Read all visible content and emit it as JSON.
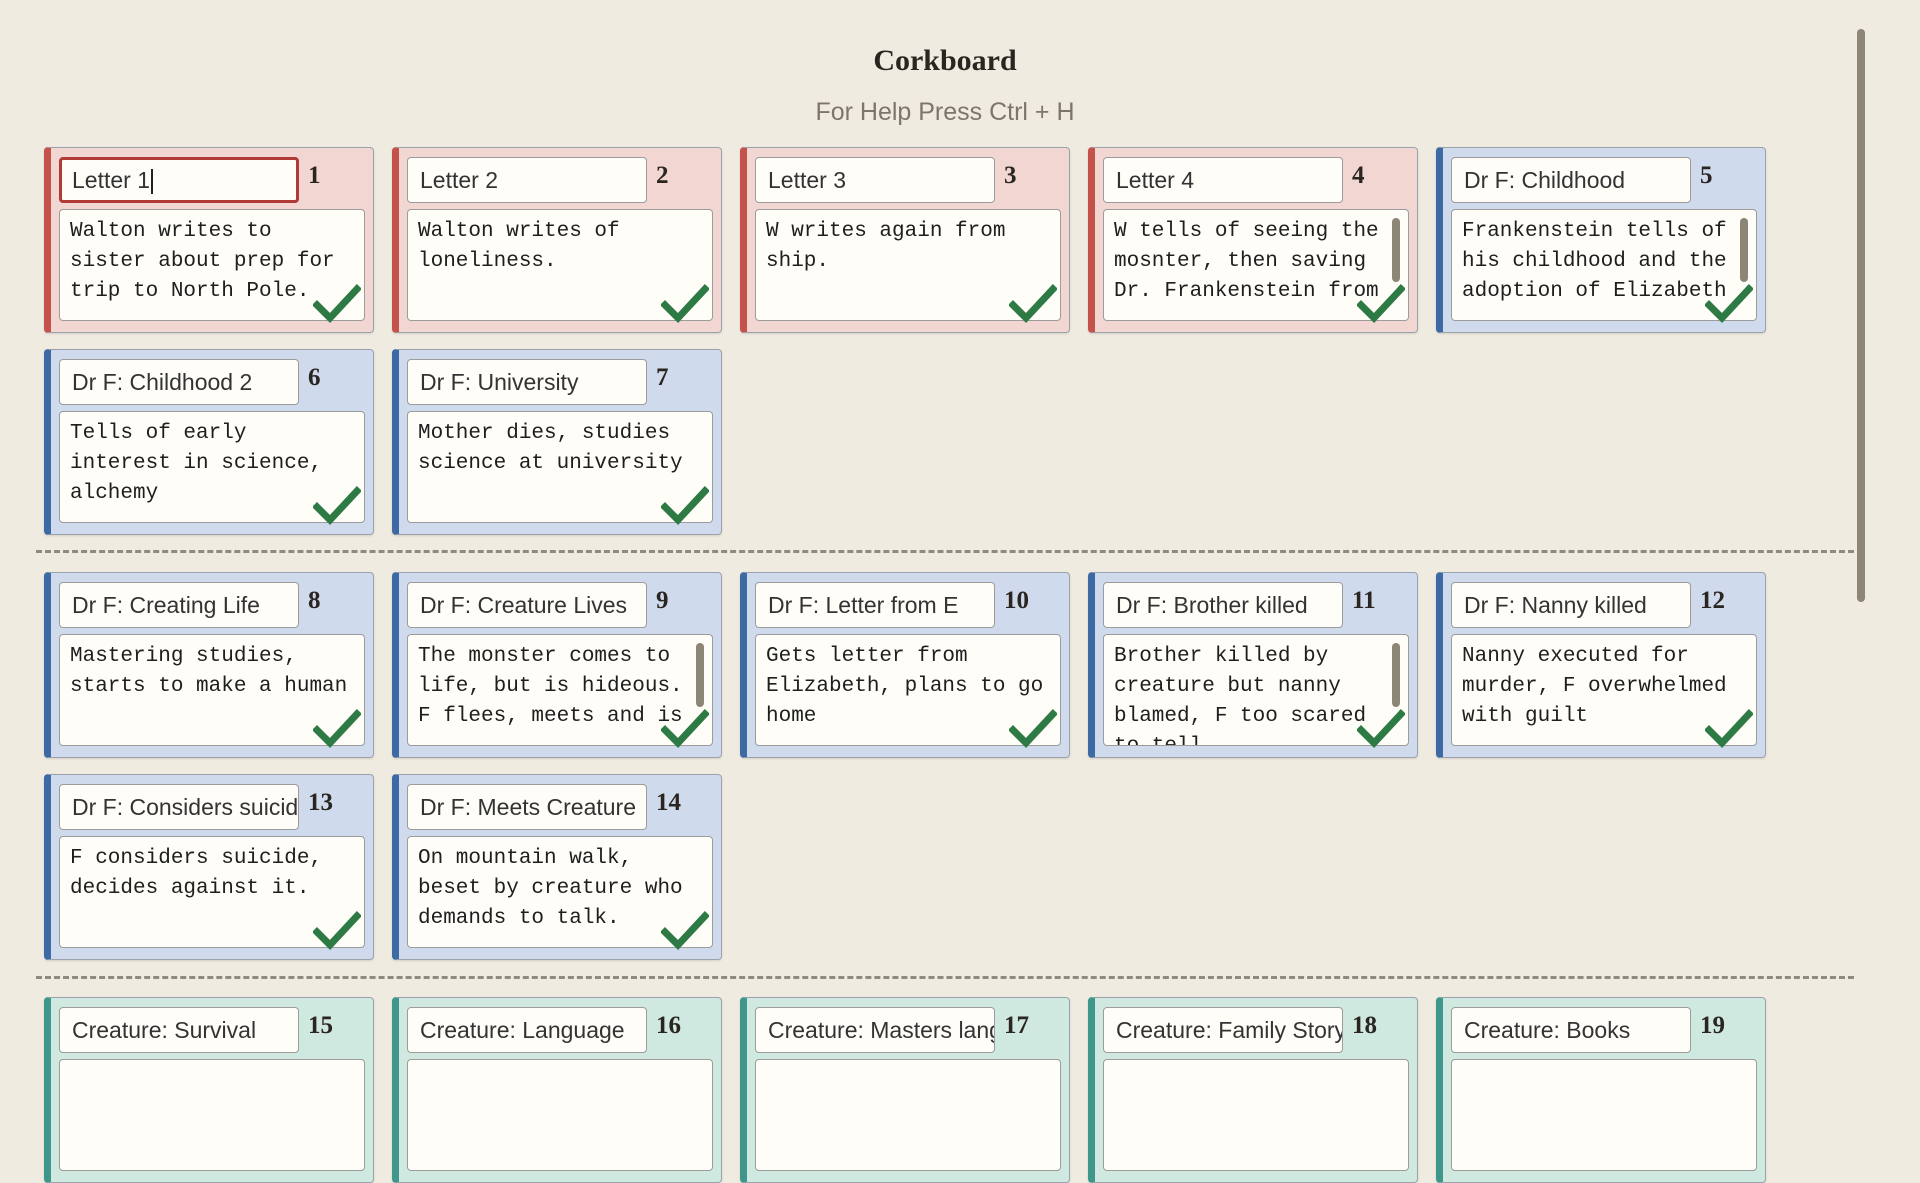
{
  "app": {
    "title": "Corkboard",
    "subtitle": "For Help Press Ctrl + H"
  },
  "colors": {
    "background": "#f0ebe1",
    "letter_card": "#f1d6d1",
    "letter_accent": "#c4524a",
    "frankenstein_card": "#cfdbec",
    "frankenstein_accent": "#3d6aa3",
    "creature_card": "#cfe8e0",
    "creature_accent": "#3f968a",
    "check": "#2e7a45"
  },
  "groups": [
    {
      "cards": [
        {
          "title": "Letter 1",
          "number": "1",
          "body": "Walton writes to sister about prep for trip to North Pole.",
          "color": "red",
          "checked": true,
          "active": true,
          "scroll": false
        },
        {
          "title": "Letter 2",
          "number": "2",
          "body": "Walton writes of loneliness.",
          "color": "red",
          "checked": true,
          "active": false,
          "scroll": false
        },
        {
          "title": "Letter 3",
          "number": "3",
          "body": "W writes again from ship.",
          "color": "red",
          "checked": true,
          "active": false,
          "scroll": false
        },
        {
          "title": "Letter 4",
          "number": "4",
          "body": "W tells of seeing the mosnter, then saving Dr. Frankenstein from",
          "color": "red",
          "checked": true,
          "active": false,
          "scroll": true
        },
        {
          "title": "Dr F: Childhood",
          "number": "5",
          "body": "Frankenstein tells of his childhood and the adoption of Elizabeth",
          "color": "blue",
          "checked": true,
          "active": false,
          "scroll": true
        },
        {
          "title": "Dr F: Childhood 2",
          "number": "6",
          "body": "Tells of early interest in science, alchemy",
          "color": "blue",
          "checked": true,
          "active": false,
          "scroll": false
        },
        {
          "title": "Dr F: University",
          "number": "7",
          "body": "Mother dies, studies science at university",
          "color": "blue",
          "checked": true,
          "active": false,
          "scroll": false
        }
      ]
    },
    {
      "cards": [
        {
          "title": "Dr F: Creating Life",
          "number": "8",
          "body": "Mastering studies, starts to make a human",
          "color": "blue",
          "checked": true,
          "active": false,
          "scroll": false
        },
        {
          "title": "Dr F: Creature Lives",
          "number": "9",
          "body": "The monster comes to life, but is hideous. F flees, meets and is",
          "color": "blue",
          "checked": true,
          "active": false,
          "scroll": true
        },
        {
          "title": "Dr F: Letter from E",
          "number": "10",
          "body": "Gets letter from Elizabeth, plans to go home",
          "color": "blue",
          "checked": true,
          "active": false,
          "scroll": false
        },
        {
          "title": "Dr F: Brother killed",
          "number": "11",
          "body": "Brother killed by creature but nanny blamed, F too scared to tell",
          "color": "blue",
          "checked": true,
          "active": false,
          "scroll": true
        },
        {
          "title": "Dr F: Nanny killed",
          "number": "12",
          "body": "Nanny executed for murder, F overwhelmed with guilt",
          "color": "blue",
          "checked": true,
          "active": false,
          "scroll": false
        },
        {
          "title": "Dr F: Considers suicide",
          "number": "13",
          "body": "F considers suicide, decides against it.",
          "color": "blue",
          "checked": true,
          "active": false,
          "scroll": false
        },
        {
          "title": "Dr F: Meets Creature",
          "number": "14",
          "body": "On mountain walk, beset by creature who demands to talk.",
          "color": "blue",
          "checked": true,
          "active": false,
          "scroll": false
        }
      ]
    },
    {
      "cards": [
        {
          "title": "Creature: Survival",
          "number": "15",
          "body": "",
          "color": "teal",
          "checked": false,
          "active": false,
          "scroll": false
        },
        {
          "title": "Creature: Language",
          "number": "16",
          "body": "",
          "color": "teal",
          "checked": false,
          "active": false,
          "scroll": false
        },
        {
          "title": "Creature: Masters language",
          "number": "17",
          "body": "",
          "color": "teal",
          "checked": false,
          "active": false,
          "scroll": false
        },
        {
          "title": "Creature: Family Story",
          "number": "18",
          "body": "",
          "color": "teal",
          "checked": false,
          "active": false,
          "scroll": false
        },
        {
          "title": "Creature: Books",
          "number": "19",
          "body": "",
          "color": "teal",
          "checked": false,
          "active": false,
          "scroll": false
        }
      ]
    }
  ]
}
